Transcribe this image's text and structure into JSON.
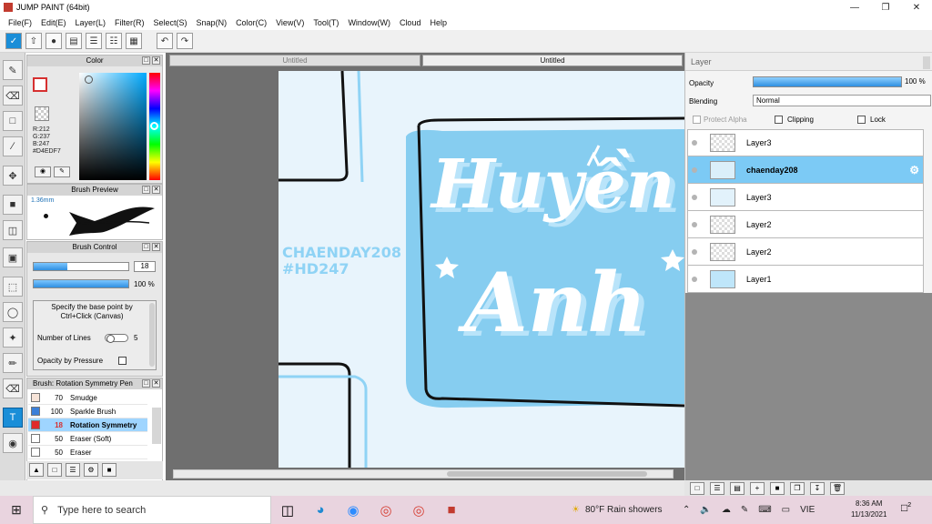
{
  "window": {
    "title": "JUMP PAINT (64bit)"
  },
  "menu": [
    "File(F)",
    "Edit(E)",
    "Layer(L)",
    "Filter(R)",
    "Select(S)",
    "Snap(N)",
    "Color(C)",
    "View(V)",
    "Tool(T)",
    "Window(W)",
    "Cloud",
    "Help"
  ],
  "color_panel": {
    "title": "Color",
    "r": "R:212",
    "g": "G:237",
    "b": "B:247",
    "hex": "#D4EDF7",
    "accent": "#D4EDF7"
  },
  "brush_preview": {
    "title": "Brush Preview",
    "size": "1.36mm"
  },
  "brush_control": {
    "title": "Brush Control",
    "size_value": "18",
    "density_value": "100 %",
    "hint": "Specify the base point by Ctrl+Click (Canvas)",
    "lines_label": "Number of Lines",
    "lines_value": "5",
    "pressure_label": "Opacity by Pressure"
  },
  "brush_list": {
    "title": "Brush: Rotation Symmetry Pen",
    "items": [
      {
        "size": "70",
        "name": "Smudge",
        "color": "#f7e4d8"
      },
      {
        "size": "100",
        "name": "Sparkle Brush",
        "color": "#3b7fd8"
      },
      {
        "size": "18",
        "name": "Rotation Symmetry",
        "color": "#e02a2a"
      },
      {
        "size": "50",
        "name": "Eraser (Soft)",
        "color": "#ffffff"
      },
      {
        "size": "50",
        "name": "Eraser",
        "color": "#ffffff"
      }
    ]
  },
  "canvas": {
    "tabs": [
      "Untitled",
      "Untitled"
    ],
    "watermark_line1": "CHAENDAY208",
    "watermark_line2": "#HD247",
    "art_line1": "Huyền",
    "art_line2": "Anh"
  },
  "layer_panel": {
    "title": "Layer",
    "opacity_label": "Opacity",
    "opacity_value": "100 %",
    "blending_label": "Blending",
    "blending_value": "Normal",
    "protect_alpha": "Protect Alpha",
    "clipping": "Clipping",
    "lock": "Lock",
    "layers": [
      "Layer3",
      "chaenday208",
      "Layer3",
      "Layer2",
      "Layer2",
      "Layer1"
    ]
  },
  "taskbar": {
    "search_placeholder": "Type here to search",
    "weather": "80°F  Rain showers",
    "lang": "VIE",
    "time": "8:36 AM",
    "date": "11/13/2021",
    "notifications": "2"
  }
}
